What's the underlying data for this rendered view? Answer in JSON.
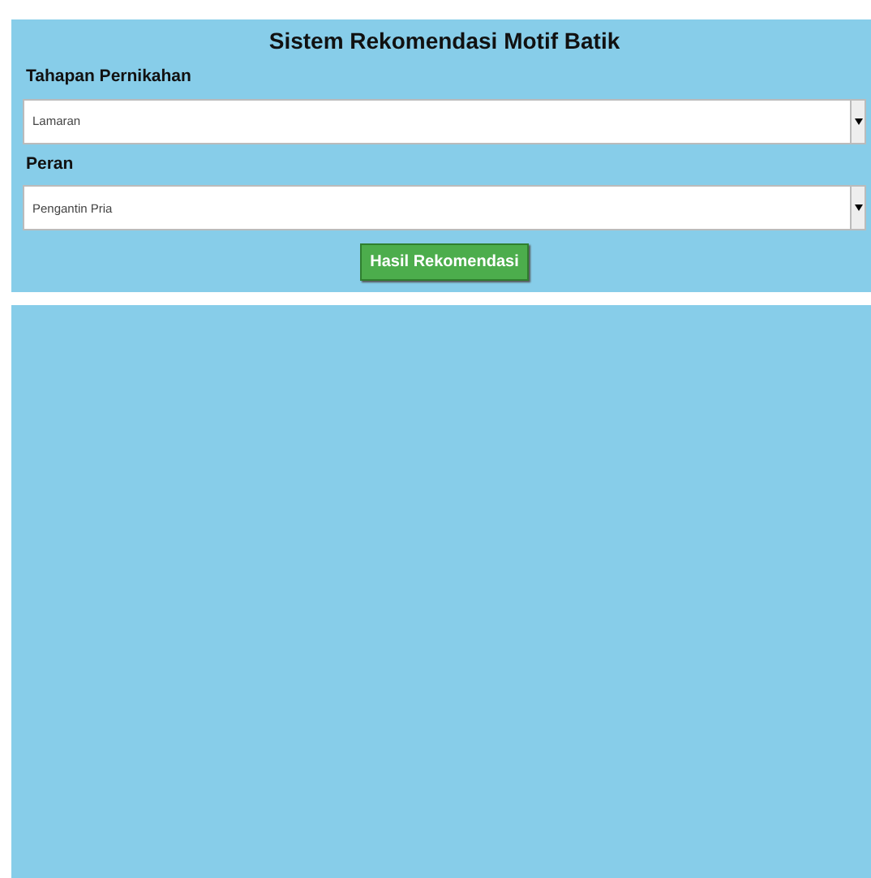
{
  "title": "Sistem Rekomendasi Motif Batik",
  "fields": [
    {
      "label": "Tahapan Pernikahan",
      "value": "Lamaran"
    },
    {
      "label": "Peran",
      "value": "Pengantin Pria"
    }
  ],
  "button": "Hasil Rekomendasi"
}
